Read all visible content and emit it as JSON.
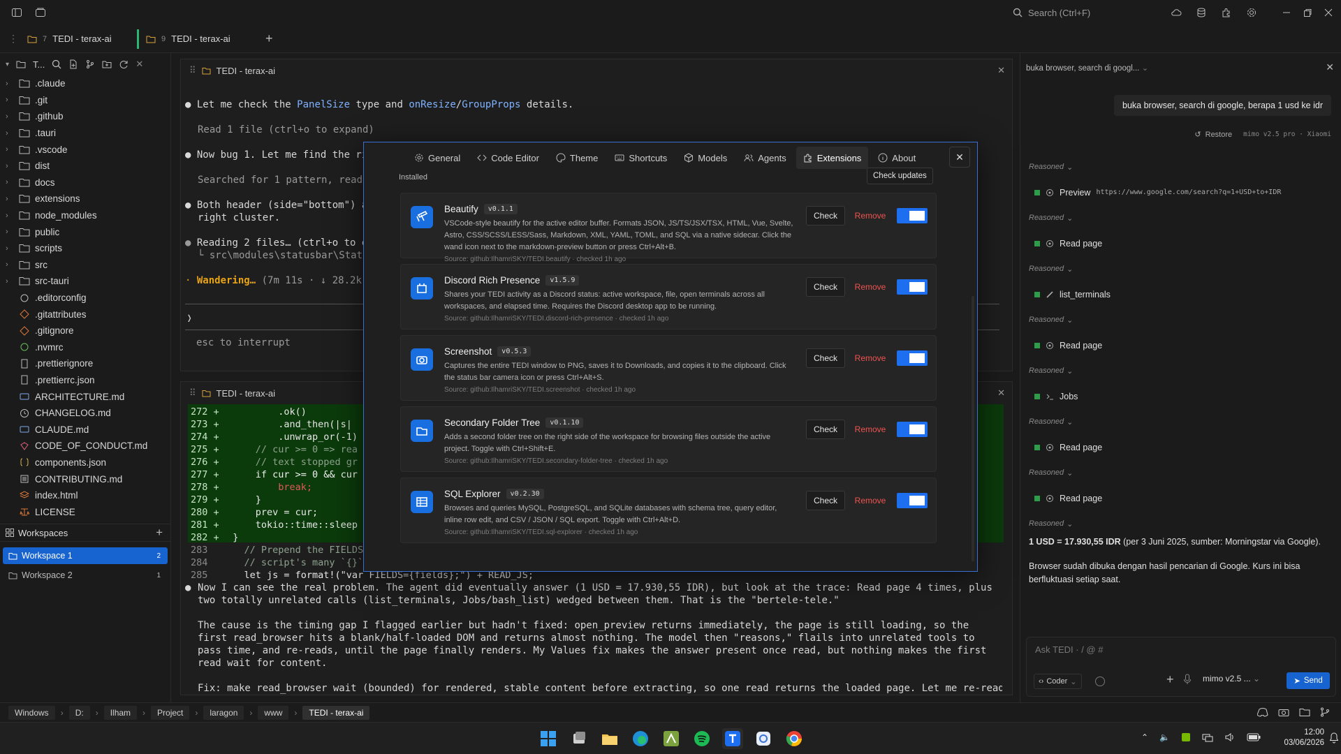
{
  "titlebar": {
    "search_placeholder": "Search (Ctrl+F)"
  },
  "tabs": [
    {
      "num": "7",
      "label": "TEDI - terax-ai"
    },
    {
      "num": "9",
      "label": "TEDI - terax-ai"
    }
  ],
  "sidebar": {
    "root_label": "T...",
    "tree": [
      {
        "label": ".claude",
        "type": "folder"
      },
      {
        "label": ".git",
        "type": "folder"
      },
      {
        "label": ".github",
        "type": "folder"
      },
      {
        "label": ".tauri",
        "type": "folder"
      },
      {
        "label": ".vscode",
        "type": "folder"
      },
      {
        "label": "dist",
        "type": "folder"
      },
      {
        "label": "docs",
        "type": "folder"
      },
      {
        "label": "extensions",
        "type": "folder"
      },
      {
        "label": "node_modules",
        "type": "folder"
      },
      {
        "label": "public",
        "type": "folder"
      },
      {
        "label": "scripts",
        "type": "folder"
      },
      {
        "label": "src",
        "type": "folder"
      },
      {
        "label": "src-tauri",
        "type": "folder"
      },
      {
        "label": ".editorconfig",
        "type": "file"
      },
      {
        "label": ".gitattributes",
        "type": "file"
      },
      {
        "label": ".gitignore",
        "type": "file"
      },
      {
        "label": ".nvmrc",
        "type": "file"
      },
      {
        "label": ".prettierignore",
        "type": "file"
      },
      {
        "label": ".prettierrc.json",
        "type": "file"
      },
      {
        "label": "ARCHITECTURE.md",
        "type": "file"
      },
      {
        "label": "CHANGELOG.md",
        "type": "file"
      },
      {
        "label": "CLAUDE.md",
        "type": "file"
      },
      {
        "label": "CODE_OF_CONDUCT.md",
        "type": "file"
      },
      {
        "label": "components.json",
        "type": "file"
      },
      {
        "label": "CONTRIBUTING.md",
        "type": "file"
      },
      {
        "label": "index.html",
        "type": "file"
      },
      {
        "label": "LICENSE",
        "type": "file"
      }
    ],
    "workspaces_label": "Workspaces",
    "workspaces": [
      {
        "label": "Workspace 1",
        "count": "2"
      },
      {
        "label": "Workspace 2",
        "count": "1"
      }
    ]
  },
  "pane_top": {
    "title": "TEDI - terax-ai",
    "lines": [
      "Let me check the PanelSize type and onResize/GroupProps details.",
      "Read 1 file (ctrl+o to expand)",
      "Now bug 1. Let me find the rig",
      "Searched for 1 pattern, read 2",
      "Both header (side=\"bottom\") an",
      "right cluster.",
      "Reading 2 files… (ctrl+o to ex",
      "└ src\\modules\\statusbar\\Statu",
      "Wandering…",
      "(7m 11s · ↓ 28.2k t",
      "❭",
      "esc to interrupt"
    ]
  },
  "pane_bottom": {
    "title": "TEDI - terax-ai",
    "diff": [
      {
        "n": "272 +",
        "code": "          .ok()"
      },
      {
        "n": "273 +",
        "code": "          .and_then(|s|"
      },
      {
        "n": "274 +",
        "code": "          .unwrap_or(-1)"
      },
      {
        "n": "275 +",
        "code": "      // cur >= 0 => rea"
      },
      {
        "n": "276 +",
        "code": "      // text stopped gr"
      },
      {
        "n": "277 +",
        "code": "      if cur >= 0 && cur"
      },
      {
        "n": "278 +",
        "code": "          break;"
      },
      {
        "n": "279 +",
        "code": "      }"
      },
      {
        "n": "280 +",
        "code": "      prev = cur;"
      },
      {
        "n": "281 +",
        "code": "      tokio::time::sleep"
      },
      {
        "n": "282 +",
        "code": "  }"
      },
      {
        "n": "283",
        "code": "    // Prepend the FIELDS"
      },
      {
        "n": "284",
        "code": "    // script's many `{}`"
      },
      {
        "n": "285",
        "code": "    let js = format!(\"var FIELDS={fields};\") + READ_JS;"
      }
    ],
    "para1": "Now I can see the real problem. The agent did eventually answer (1 USD = 17.930,55 IDR), but look at the trace: Read page 4 times, plus two totally unrelated calls (list_terminals, Jobs/bash_list) wedged between them. That is the \"bertele-tele.\"",
    "para2": "The cause is the timing gap I flagged earlier but hadn't fixed: open_preview returns immediately, the page is still loading, so the first read_browser hits a blank/half-loaded DOM and returns almost nothing. The model then \"reasons,\" flails into unrelated tools to pass time, and re-reads, until the page finally renders. My Values fix makes the answer present once read, but nothing makes the first read wait for content.",
    "para3": "Fix: make read_browser wait (bounded) for rendered, stable content before extracting, so one read returns the loaded page. Let me re-read the"
  },
  "modal": {
    "tabs": [
      {
        "label": "General",
        "icon": "gear-icon"
      },
      {
        "label": "Code Editor",
        "icon": "code-icon"
      },
      {
        "label": "Theme",
        "icon": "palette-icon"
      },
      {
        "label": "Shortcuts",
        "icon": "keyboard-icon"
      },
      {
        "label": "Models",
        "icon": "cube-icon"
      },
      {
        "label": "Agents",
        "icon": "users-icon"
      },
      {
        "label": "Extensions",
        "icon": "puzzle-icon"
      },
      {
        "label": "About",
        "icon": "info-icon"
      }
    ],
    "active_tab": "Extensions",
    "installed_label": "Installed",
    "check_updates_label": "Check updates",
    "check_label": "Check",
    "remove_label": "Remove",
    "extensions": [
      {
        "name": "Beautify",
        "version": "v0.1.1",
        "desc": "VSCode-style beautify for the active editor buffer. Formats JSON, JS/TS/JSX/TSX, HTML, Vue, Svelte, Astro, CSS/SCSS/LESS/Sass, Markdown, XML, YAML, TOML, and SQL via a native sidecar. Click the wand icon next to the markdown-preview button or press Ctrl+Alt+B.",
        "source": "Source: github:IlhamriSKY/TEDI.beautify · checked 1h ago",
        "enabled": true
      },
      {
        "name": "Discord Rich Presence",
        "version": "v1.5.9",
        "desc": "Shares your TEDI activity as a Discord status: active workspace, file, open terminals across all workspaces, and elapsed time. Requires the Discord desktop app to be running.",
        "source": "Source: github:IlhamriSKY/TEDI.discord-rich-presence · checked 1h ago",
        "enabled": true
      },
      {
        "name": "Screenshot",
        "version": "v0.5.3",
        "desc": "Captures the entire TEDI window to PNG, saves it to Downloads, and copies it to the clipboard. Click the status bar camera icon or press Ctrl+Alt+S.",
        "source": "Source: github:IlhamriSKY/TEDI.screenshot · checked 1h ago",
        "enabled": true
      },
      {
        "name": "Secondary Folder Tree",
        "version": "v0.1.10",
        "desc": "Adds a second folder tree on the right side of the workspace for browsing files outside the active project. Toggle with Ctrl+Shift+E.",
        "source": "Source: github:IlhamriSKY/TEDI.secondary-folder-tree · checked 1h ago",
        "enabled": true
      },
      {
        "name": "SQL Explorer",
        "version": "v0.2.30",
        "desc": "Browses and queries MySQL, PostgreSQL, and SQLite databases with schema tree, query editor, inline row edit, and CSV / JSON / SQL export. Toggle with Ctrl+Alt+D.",
        "source": "Source: github:IlhamriSKY/TEDI.sql-explorer · checked 1h ago",
        "enabled": true
      }
    ]
  },
  "rpanel": {
    "session_title": "buka browser, search di googl...",
    "user_msg": "buka browser, search di google, berapa 1 usd ke idr",
    "restore_label": "Restore",
    "model_tag": "mimo v2.5 pro · Xiaomi",
    "reasoned_label": "Reasoned",
    "steps": [
      {
        "label": "Preview",
        "detail": "https://www.google.com/search?q=1+USD+to+IDR"
      },
      {
        "label": "Read page",
        "detail": ""
      },
      {
        "label": "list_terminals",
        "detail": ""
      },
      {
        "label": "Read page",
        "detail": ""
      },
      {
        "label": "Jobs",
        "detail": ""
      },
      {
        "label": "Read page",
        "detail": ""
      },
      {
        "label": "Read page",
        "detail": ""
      }
    ],
    "answer_bold": "1 USD = 17.930,55 IDR",
    "answer_rest": " (per 3 Juni 2025, sumber: Morningstar via Google).",
    "answer2": "Browser sudah dibuka dengan hasil pencarian di Google. Kurs ini bisa berfluktuasi setiap saat.",
    "input_placeholder": "Ask TEDI · / @ #",
    "mode_label": "Coder",
    "model_label": "mimo v2.5 ...",
    "send_label": "Send"
  },
  "statusbar": {
    "crumbs": [
      "Windows",
      "D:",
      "Ilham",
      "Project",
      "laragon",
      "www",
      "TEDI - terax-ai"
    ]
  },
  "taskbar": {
    "time": "12:00",
    "date": "03/06/2026"
  },
  "colors": {
    "accent": "#1e6ef0",
    "remove": "#ef5350",
    "diff_add_bg": "#0b3a0b",
    "status_ok": "#2e9d4a"
  }
}
